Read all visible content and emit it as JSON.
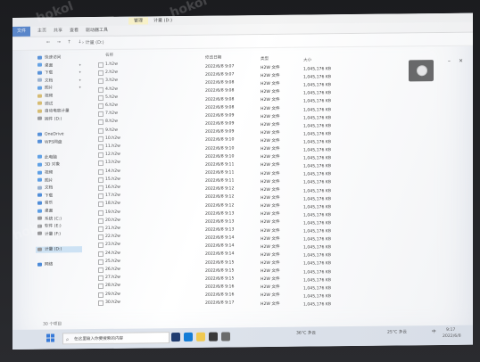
{
  "titlebar": {
    "tab_label": "管理",
    "window_title": "计量 (D:)"
  },
  "ribbon": {
    "file": "文件",
    "tabs": [
      "主页",
      "共享",
      "查看",
      "驱动器工具"
    ]
  },
  "address": {
    "nav": "← → ↑ ↓",
    "path": "› 计量 (D:)"
  },
  "nav_pane": [
    {
      "label": "快速访问",
      "color": "#2b78d6"
    },
    {
      "label": "桌面",
      "color": "#3a8ee6"
    },
    {
      "label": "下载",
      "color": "#2b78d6"
    },
    {
      "label": "文档",
      "color": "#8aa6c8"
    },
    {
      "label": "图片",
      "color": "#3a8ee6"
    },
    {
      "label": "视频",
      "color": "#d8b24a"
    },
    {
      "label": "调试",
      "color": "#d8b24a"
    },
    {
      "label": "自动电容计量",
      "color": "#d8b24a"
    },
    {
      "label": "固件 (D:)",
      "color": "#888888"
    },
    {
      "label": "",
      "color": "#ffffff"
    },
    {
      "label": "OneDrive",
      "color": "#2b78d6"
    },
    {
      "label": "WPS网盘",
      "color": "#2b78d6"
    },
    {
      "label": "",
      "color": "#ffffff"
    },
    {
      "label": "此电脑",
      "color": "#3a8ee6"
    },
    {
      "label": "3D 对象",
      "color": "#3a8ee6"
    },
    {
      "label": "视频",
      "color": "#3a8ee6"
    },
    {
      "label": "图片",
      "color": "#3a8ee6"
    },
    {
      "label": "文档",
      "color": "#8aa6c8"
    },
    {
      "label": "下载",
      "color": "#2b78d6"
    },
    {
      "label": "音乐",
      "color": "#2b78d6"
    },
    {
      "label": "桌面",
      "color": "#3a8ee6"
    },
    {
      "label": "系统 (C:)",
      "color": "#888888"
    },
    {
      "label": "软件 (E:)",
      "color": "#888888"
    },
    {
      "label": "计量 (F:)",
      "color": "#888888"
    },
    {
      "label": "",
      "color": "#ffffff"
    },
    {
      "label": "计量 (D:)",
      "color": "#888888",
      "selected": true
    },
    {
      "label": "",
      "color": "#ffffff"
    },
    {
      "label": "网络",
      "color": "#2b78d6"
    }
  ],
  "columns": {
    "name": "名称",
    "date": "修改日期",
    "type": "类型",
    "size": "大小"
  },
  "files": [
    {
      "name": "1.h2w",
      "date": "2022/6/8 9:07",
      "type": "H2W 文件",
      "size": "1,045,176 KB"
    },
    {
      "name": "2.h2w",
      "date": "2022/6/8 9:07",
      "type": "H2W 文件",
      "size": "1,045,176 KB"
    },
    {
      "name": "3.h2w",
      "date": "2022/6/8 9:08",
      "type": "H2W 文件",
      "size": "1,045,176 KB"
    },
    {
      "name": "4.h2w",
      "date": "2022/6/8 9:08",
      "type": "H2W 文件",
      "size": "1,045,176 KB"
    },
    {
      "name": "5.h2w",
      "date": "2022/6/8 9:08",
      "type": "H2W 文件",
      "size": "1,045,176 KB"
    },
    {
      "name": "6.h2w",
      "date": "2022/6/8 9:08",
      "type": "H2W 文件",
      "size": "1,045,176 KB"
    },
    {
      "name": "7.h2w",
      "date": "2022/6/8 9:09",
      "type": "H2W 文件",
      "size": "1,045,176 KB"
    },
    {
      "name": "8.h2w",
      "date": "2022/6/8 9:09",
      "type": "H2W 文件",
      "size": "1,045,176 KB"
    },
    {
      "name": "9.h2w",
      "date": "2022/6/8 9:09",
      "type": "H2W 文件",
      "size": "1,045,176 KB"
    },
    {
      "name": "10.h2w",
      "date": "2022/6/8 9:10",
      "type": "H2W 文件",
      "size": "1,045,176 KB"
    },
    {
      "name": "11.h2w",
      "date": "2022/6/8 9:10",
      "type": "H2W 文件",
      "size": "1,045,176 KB"
    },
    {
      "name": "12.h2w",
      "date": "2022/6/8 9:10",
      "type": "H2W 文件",
      "size": "1,045,176 KB"
    },
    {
      "name": "13.h2w",
      "date": "2022/6/8 9:11",
      "type": "H2W 文件",
      "size": "1,045,176 KB"
    },
    {
      "name": "14.h2w",
      "date": "2022/6/8 9:11",
      "type": "H2W 文件",
      "size": "1,045,176 KB"
    },
    {
      "name": "15.h2w",
      "date": "2022/6/8 9:11",
      "type": "H2W 文件",
      "size": "1,045,176 KB"
    },
    {
      "name": "16.h2w",
      "date": "2022/6/8 9:12",
      "type": "H2W 文件",
      "size": "1,045,176 KB"
    },
    {
      "name": "17.h2w",
      "date": "2022/6/8 9:12",
      "type": "H2W 文件",
      "size": "1,045,176 KB"
    },
    {
      "name": "18.h2w",
      "date": "2022/6/8 9:12",
      "type": "H2W 文件",
      "size": "1,045,176 KB"
    },
    {
      "name": "19.h2w",
      "date": "2022/6/8 9:13",
      "type": "H2W 文件",
      "size": "1,045,176 KB"
    },
    {
      "name": "20.h2w",
      "date": "2022/6/8 9:13",
      "type": "H2W 文件",
      "size": "1,045,176 KB"
    },
    {
      "name": "21.h2w",
      "date": "2022/6/8 9:13",
      "type": "H2W 文件",
      "size": "1,045,176 KB"
    },
    {
      "name": "22.h2w",
      "date": "2022/6/8 9:14",
      "type": "H2W 文件",
      "size": "1,045,176 KB"
    },
    {
      "name": "23.h2w",
      "date": "2022/6/8 9:14",
      "type": "H2W 文件",
      "size": "1,045,176 KB"
    },
    {
      "name": "24.h2w",
      "date": "2022/6/8 9:14",
      "type": "H2W 文件",
      "size": "1,045,176 KB"
    },
    {
      "name": "25.h2w",
      "date": "2022/6/8 9:15",
      "type": "H2W 文件",
      "size": "1,045,176 KB"
    },
    {
      "name": "26.h2w",
      "date": "2022/6/8 9:15",
      "type": "H2W 文件",
      "size": "1,045,176 KB"
    },
    {
      "name": "27.h2w",
      "date": "2022/6/8 9:15",
      "type": "H2W 文件",
      "size": "1,045,176 KB"
    },
    {
      "name": "28.h2w",
      "date": "2022/6/8 9:16",
      "type": "H2W 文件",
      "size": "1,045,176 KB"
    },
    {
      "name": "29.h2w",
      "date": "2022/6/8 9:16",
      "type": "H2W 文件",
      "size": "1,045,176 KB"
    },
    {
      "name": "30.h2w",
      "date": "2022/6/8 9:17",
      "type": "H2W 文件",
      "size": "1,045,176 KB"
    }
  ],
  "status": {
    "items": "30 个项目"
  },
  "taskbar": {
    "search_placeholder": "在这里输入你要搜索的内容",
    "weather": "25°C 多云",
    "tray_lang": "中",
    "time": "9:17",
    "date": "2022/6/8",
    "mid_text": "36°C 多云"
  },
  "watermark": "hokol",
  "icons": {
    "search": "search-icon",
    "camera": "camera-icon"
  }
}
